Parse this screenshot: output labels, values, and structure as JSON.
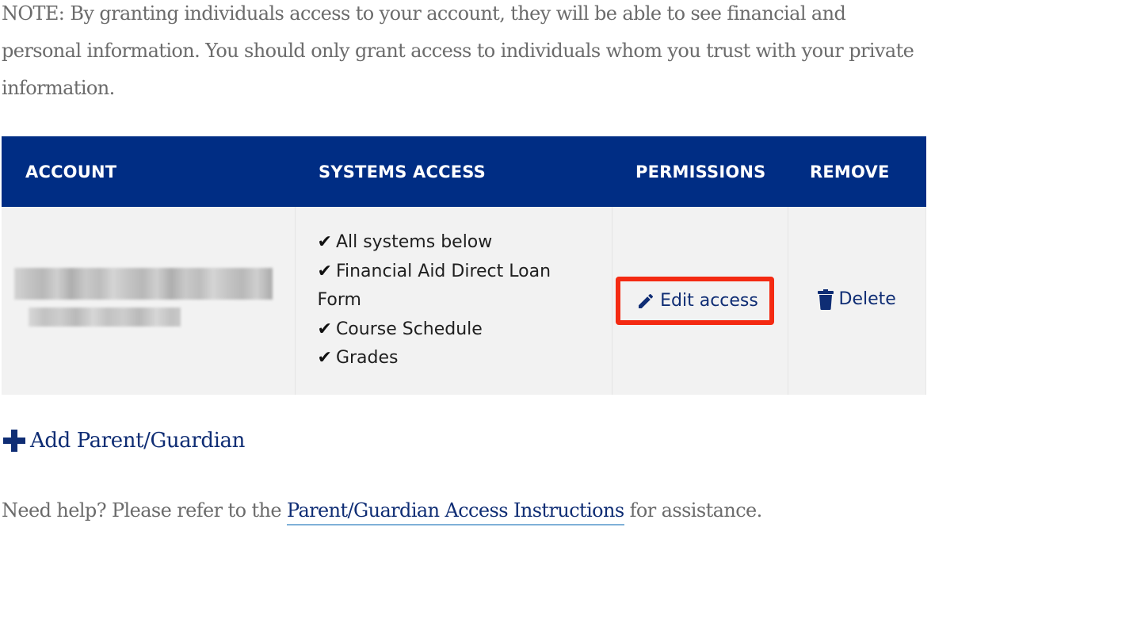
{
  "note": "NOTE: By granting individuals access to your account, they will be able to see financial and personal information. You should only grant access to individuals whom you trust with your private information.",
  "table": {
    "headers": [
      "ACCOUNT",
      "SYSTEMS ACCESS",
      "PERMISSIONS",
      "REMOVE"
    ],
    "rows": [
      {
        "account": "",
        "systems": [
          "All systems below",
          "Financial Aid Direct Loan Form",
          "Course Schedule",
          "Grades"
        ],
        "permissions_label": "Edit access",
        "remove_label": "Delete"
      }
    ]
  },
  "add_parent_label": "Add Parent/Guardian",
  "help": {
    "prefix": "Need help? Please refer to the ",
    "link_text": "Parent/Guardian Access Instructions",
    "suffix": " for assistance."
  },
  "icons": {
    "check": "check-icon",
    "edit": "pencil-icon",
    "delete": "trash-icon",
    "add": "plus-icon"
  },
  "colors": {
    "header_bg": "#002d84",
    "link": "#0f2d74",
    "highlight_border": "#f42a12",
    "row_bg": "#f2f2f2"
  }
}
